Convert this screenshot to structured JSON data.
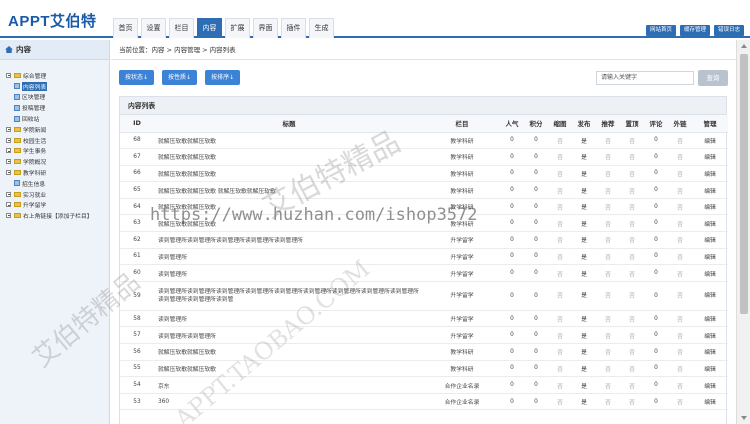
{
  "app": {
    "logo": "APPT艾伯特"
  },
  "nav": [
    {
      "label": "首页"
    },
    {
      "label": "设置"
    },
    {
      "label": "栏目"
    },
    {
      "label": "内容",
      "active": true
    },
    {
      "label": "扩展"
    },
    {
      "label": "界面"
    },
    {
      "label": "插件"
    },
    {
      "label": "生成"
    }
  ],
  "top_buttons": [
    "网站首页",
    "缓存管理",
    "错误日志"
  ],
  "sidebar": {
    "title": "内容",
    "tree": [
      {
        "label": "综合管理",
        "type": "folder",
        "level": 0
      },
      {
        "label": "内容列表",
        "type": "doc",
        "level": 1,
        "selected": true
      },
      {
        "label": "区块管理",
        "type": "doc",
        "level": 1
      },
      {
        "label": "投稿管理",
        "type": "doc",
        "level": 1
      },
      {
        "label": "回收站",
        "type": "doc",
        "level": 1
      },
      {
        "label": "学院新闻",
        "type": "folder",
        "level": 0
      },
      {
        "label": "校园生活",
        "type": "folder",
        "level": 0
      },
      {
        "label": "学生事务",
        "type": "folder",
        "level": 0
      },
      {
        "label": "学院概况",
        "type": "folder",
        "level": 0
      },
      {
        "label": "教学科研",
        "type": "folder",
        "level": 0
      },
      {
        "label": "招生信息",
        "type": "doc",
        "level": 0
      },
      {
        "label": "实习就业",
        "type": "folder",
        "level": 0
      },
      {
        "label": "升学留学",
        "type": "folder",
        "level": 0
      },
      {
        "label": "右上角链接【添加子栏目】",
        "type": "folder",
        "level": 0
      }
    ]
  },
  "breadcrumb": "当前位置：内容 > 内容管理 > 内容列表",
  "toolbar": [
    "按状态↓",
    "按性质↓",
    "按排序↓"
  ],
  "search": {
    "placeholder": "请输入关键字",
    "button": "查询"
  },
  "panel_title": "内容列表",
  "columns": [
    "ID",
    "标题",
    "栏目",
    "人气",
    "积分",
    "缩图",
    "发布",
    "推荐",
    "置顶",
    "评论",
    "外链",
    "管理"
  ],
  "rows": [
    {
      "id": "68",
      "title": "就解压软歌就解压软歌",
      "cat": "教学科研",
      "pop": "0",
      "pts": "0",
      "thumb": "否",
      "pub": "是",
      "rec": "否",
      "top": "否",
      "cmt": "0",
      "ext": "否",
      "op": "编辑"
    },
    {
      "id": "67",
      "title": "就解压软歌就解压软歌",
      "cat": "教学科研",
      "pop": "0",
      "pts": "0",
      "thumb": "否",
      "pub": "是",
      "rec": "否",
      "top": "否",
      "cmt": "0",
      "ext": "否",
      "op": "编辑"
    },
    {
      "id": "66",
      "title": "就解压软歌就解压软歌",
      "cat": "教学科研",
      "pop": "0",
      "pts": "0",
      "thumb": "否",
      "pub": "是",
      "rec": "否",
      "top": "否",
      "cmt": "0",
      "ext": "否",
      "op": "编辑"
    },
    {
      "id": "65",
      "title": "就解压软歌就解压软歌 就解压软歌就解压软歌",
      "cat": "教学科研",
      "pop": "0",
      "pts": "0",
      "thumb": "否",
      "pub": "是",
      "rec": "否",
      "top": "否",
      "cmt": "0",
      "ext": "否",
      "op": "编辑"
    },
    {
      "id": "64",
      "title": "就解压软歌就解压软歌",
      "cat": "教学科研",
      "pop": "0",
      "pts": "0",
      "thumb": "否",
      "pub": "是",
      "rec": "否",
      "top": "否",
      "cmt": "0",
      "ext": "否",
      "op": "编辑"
    },
    {
      "id": "63",
      "title": "就解压软歌就解压软歌",
      "cat": "教学科研",
      "pop": "0",
      "pts": "0",
      "thumb": "否",
      "pub": "是",
      "rec": "否",
      "top": "否",
      "cmt": "0",
      "ext": "否",
      "op": "编辑"
    },
    {
      "id": "62",
      "title": "读到管理所读到管理所读到管理所读到管理所读到管理所",
      "cat": "升学留学",
      "pop": "0",
      "pts": "0",
      "thumb": "否",
      "pub": "是",
      "rec": "否",
      "top": "否",
      "cmt": "0",
      "ext": "否",
      "op": "编辑"
    },
    {
      "id": "61",
      "title": "读到管理所",
      "cat": "升学留学",
      "pop": "0",
      "pts": "0",
      "thumb": "否",
      "pub": "是",
      "rec": "否",
      "top": "否",
      "cmt": "0",
      "ext": "否",
      "op": "编辑"
    },
    {
      "id": "60",
      "title": "读到管理所",
      "cat": "升学留学",
      "pop": "0",
      "pts": "0",
      "thumb": "否",
      "pub": "是",
      "rec": "否",
      "top": "否",
      "cmt": "0",
      "ext": "否",
      "op": "编辑"
    },
    {
      "id": "59",
      "title": "读到管理所读到管理所读到管理所读到管理所读到管理所读到管理所读到管理所读到管理所读到管理所读到管理所读到管理所读到管",
      "cat": "升学留学",
      "pop": "0",
      "pts": "0",
      "thumb": "否",
      "pub": "是",
      "rec": "否",
      "top": "否",
      "cmt": "0",
      "ext": "否",
      "op": "编辑",
      "tall": true
    },
    {
      "id": "58",
      "title": "读到管理所",
      "cat": "升学留学",
      "pop": "0",
      "pts": "0",
      "thumb": "否",
      "pub": "是",
      "rec": "否",
      "top": "否",
      "cmt": "0",
      "ext": "否",
      "op": "编辑"
    },
    {
      "id": "57",
      "title": "读到管理所读到管理所",
      "cat": "升学留学",
      "pop": "0",
      "pts": "0",
      "thumb": "否",
      "pub": "是",
      "rec": "否",
      "top": "否",
      "cmt": "0",
      "ext": "否",
      "op": "编辑"
    },
    {
      "id": "56",
      "title": "就解压软歌就解压软歌",
      "cat": "教学科研",
      "pop": "0",
      "pts": "0",
      "thumb": "否",
      "pub": "是",
      "rec": "否",
      "top": "否",
      "cmt": "0",
      "ext": "否",
      "op": "编辑"
    },
    {
      "id": "55",
      "title": "就解压软歌就解压软歌",
      "cat": "教学科研",
      "pop": "0",
      "pts": "0",
      "thumb": "否",
      "pub": "是",
      "rec": "否",
      "top": "否",
      "cmt": "0",
      "ext": "否",
      "op": "编辑"
    },
    {
      "id": "54",
      "title": "京东",
      "cat": "合作企业名录",
      "pop": "0",
      "pts": "0",
      "thumb": "否",
      "pub": "是",
      "rec": "否",
      "top": "否",
      "cmt": "0",
      "ext": "否",
      "op": "编辑"
    },
    {
      "id": "53",
      "title": "360",
      "cat": "合作企业名录",
      "pop": "0",
      "pts": "0",
      "thumb": "否",
      "pub": "是",
      "rec": "否",
      "top": "否",
      "cmt": "0",
      "ext": "否",
      "op": "编辑"
    }
  ],
  "watermarks": {
    "url": "https://www.huzhan.com/ishop3572",
    "text1": "艾伯特精品",
    "text2": "艾伯特精品",
    "text3": "APPT.TAOBAO.COM"
  }
}
